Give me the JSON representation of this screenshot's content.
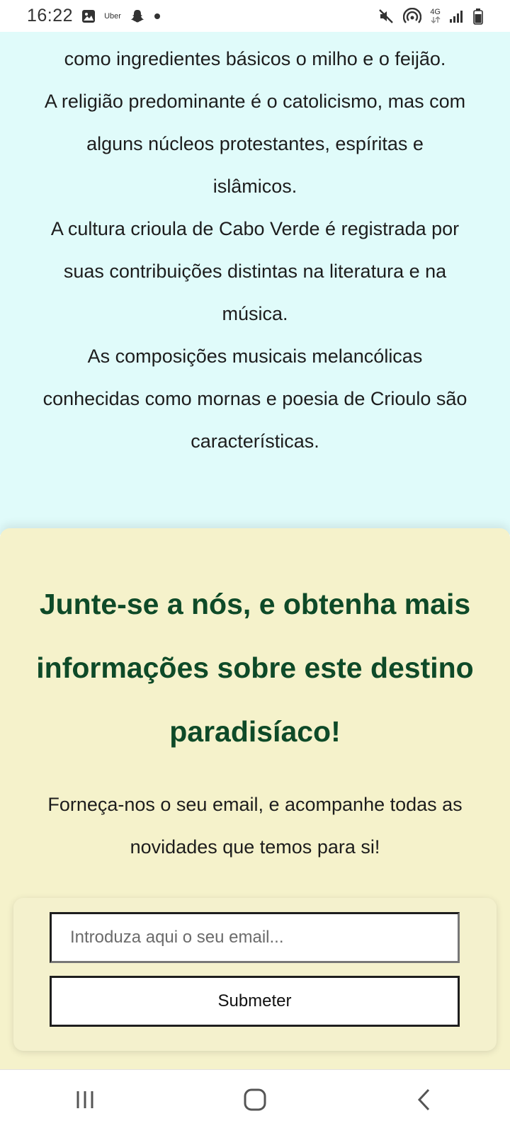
{
  "status_bar": {
    "time": "16:22",
    "left_icons": [
      "gallery-icon",
      "uber-icon",
      "snapchat-icon",
      "notification-dot-icon"
    ],
    "uber_text": "Uber",
    "network_label": "4G",
    "right_icons": [
      "mute-icon",
      "hotspot-icon",
      "network-4g-icon",
      "signal-icon",
      "battery-icon"
    ]
  },
  "article": {
    "paragraphs": [
      "como ingredientes básicos o milho e o feijão.",
      "A religião predominante é o catolicismo, mas com alguns núcleos protestantes, espíritas e islâmicos.",
      "A cultura crioula de Cabo Verde é registrada por suas contribuições distintas na literatura e na música.",
      "As composições musicais melancólicas conhecidas como mornas e poesia de Crioulo são características."
    ]
  },
  "newsletter": {
    "title": "Junte-se a nós, e obtenha mais informações sobre este destino paradisíaco!",
    "subtitle": "Forneça-nos o seu email, e acompanhe todas as novidades que temos para si!",
    "email_placeholder": "Introduza aqui o seu email...",
    "email_value": "",
    "submit_label": "Submeter"
  },
  "nav_bar": {
    "buttons": [
      "recent-apps-icon",
      "home-icon",
      "back-icon"
    ]
  },
  "colors": {
    "article_bg": "#e0fbfa",
    "newsletter_bg": "#f5f2cb",
    "title_color": "#0e4a28"
  }
}
